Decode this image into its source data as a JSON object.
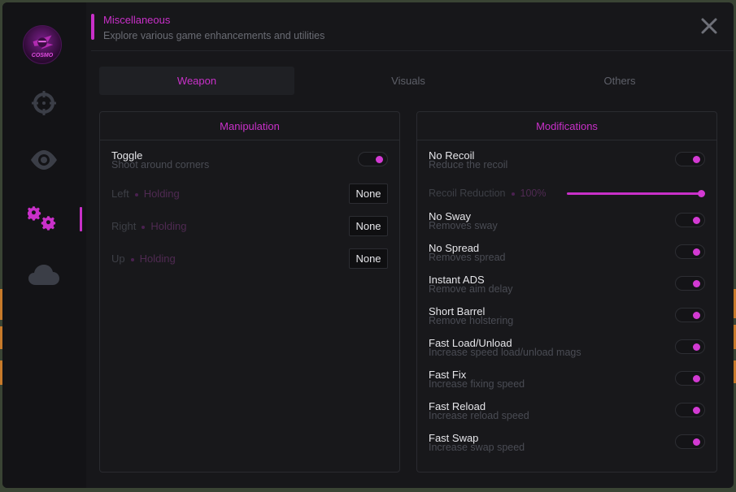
{
  "brand": {
    "logo_text": "COSMO"
  },
  "sidebar": {
    "items": [
      {
        "icon": "crosshair-icon",
        "active": false
      },
      {
        "icon": "eye-icon",
        "active": false
      },
      {
        "icon": "gears-icon",
        "active": true
      },
      {
        "icon": "cloud-icon",
        "active": false
      }
    ]
  },
  "header": {
    "title": "Miscellaneous",
    "subtitle": "Explore various game enhancements and utilities"
  },
  "tabs": [
    {
      "label": "Weapon",
      "active": true
    },
    {
      "label": "Visuals",
      "active": false
    },
    {
      "label": "Others",
      "active": false
    }
  ],
  "manipulation": {
    "title": "Manipulation",
    "toggle": {
      "label": "Toggle",
      "desc": "Shoot around corners",
      "on": true
    },
    "binds": [
      {
        "label": "Left",
        "mode": "Holding",
        "key": "None"
      },
      {
        "label": "Right",
        "mode": "Holding",
        "key": "None"
      },
      {
        "label": "Up",
        "mode": "Holding",
        "key": "None"
      }
    ]
  },
  "modifications": {
    "title": "Modifications",
    "no_recoil": {
      "label": "No Recoil",
      "desc": "Reduce the recoil",
      "on": true
    },
    "recoil_slider": {
      "label": "Recoil Reduction",
      "value": "100%",
      "fraction": 1.0
    },
    "items": [
      {
        "label": "No Sway",
        "desc": "Removes sway",
        "on": true
      },
      {
        "label": "No Spread",
        "desc": "Removes spread",
        "on": true
      },
      {
        "label": "Instant ADS",
        "desc": "Remove aim delay",
        "on": true
      },
      {
        "label": "Short Barrel",
        "desc": "Remove holstering",
        "on": true
      },
      {
        "label": "Fast Load/Unload",
        "desc": "Increase speed load/unload mags",
        "on": true
      },
      {
        "label": "Fast Fix",
        "desc": "Increase fixing speed",
        "on": true
      },
      {
        "label": "Fast Reload",
        "desc": "Increase reload speed",
        "on": true
      },
      {
        "label": "Fast Swap",
        "desc": "Increase swap speed",
        "on": true
      }
    ]
  },
  "colors": {
    "accent": "#c930c9",
    "background": "#17171a",
    "sidebar": "#131316"
  }
}
